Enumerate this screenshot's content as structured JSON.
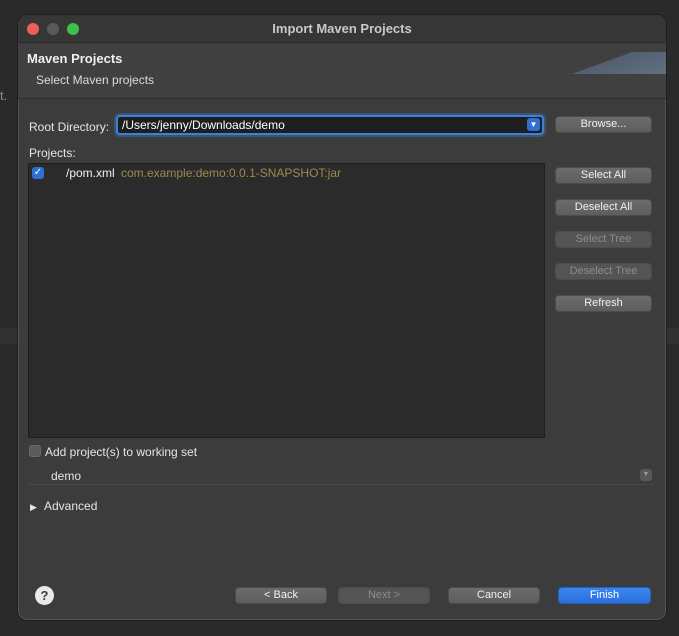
{
  "background": {
    "stray_text": "t."
  },
  "window": {
    "title": "Import Maven Projects",
    "traffic_lights": [
      "close",
      "minimize",
      "maximize"
    ]
  },
  "header": {
    "title": "Maven Projects",
    "subtitle": "Select Maven projects"
  },
  "root_directory": {
    "label": "Root Directory:",
    "value": "/Users/jenny/Downloads/demo",
    "browse_label": "Browse..."
  },
  "projects": {
    "label": "Projects:",
    "items": [
      {
        "name": "/pom.xml",
        "artifact": "com.example:demo:0.0.1-SNAPSHOT:jar",
        "checked": true
      }
    ]
  },
  "side_buttons": {
    "select_all": "Select All",
    "deselect_all": "Deselect All",
    "select_tree": "Select Tree",
    "deselect_tree": "Deselect Tree",
    "refresh": "Refresh"
  },
  "working_set": {
    "label": "Add project(s) to working set",
    "checked": false,
    "value": "demo"
  },
  "advanced": {
    "label": "Advanced"
  },
  "footer": {
    "back": "< Back",
    "next": "Next >",
    "cancel": "Cancel",
    "finish": "Finish"
  },
  "colors": {
    "accent": "#2f6fd1",
    "artifact_text": "#a0884e",
    "window_bg": "#3c3c3c"
  }
}
